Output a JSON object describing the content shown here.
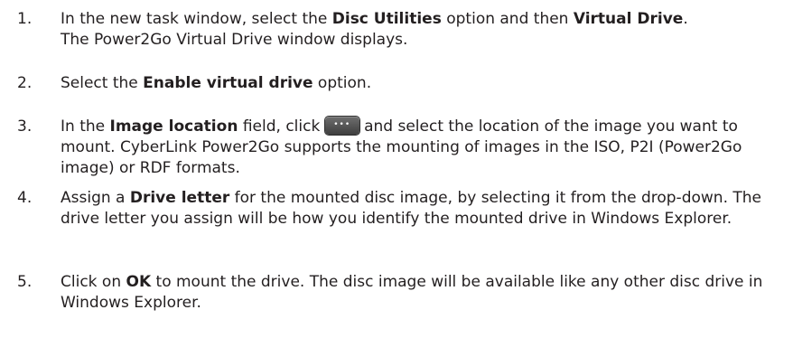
{
  "steps": [
    {
      "number": "1.",
      "parts": {
        "a": "In the new task window, select the ",
        "b": "Disc Utilities",
        "c": " option and then ",
        "d": "Virtual Drive",
        "e": ".",
        "f": "The Power2Go Virtual Drive window displays."
      }
    },
    {
      "number": "2.",
      "parts": {
        "a": "Select the ",
        "b": "Enable virtual drive",
        "c": " option."
      }
    },
    {
      "number": "3.",
      "parts": {
        "a": "In the ",
        "b": "Image location",
        "c": " field, click ",
        "d": " and select the location of the image you want to mount. CyberLink Power2Go supports the mounting of images in the ISO, P2I (Power2Go image) or RDF formats."
      }
    },
    {
      "number": "4.",
      "parts": {
        "a": "Assign a ",
        "b": "Drive letter",
        "c": " for the mounted disc image, by selecting it from the drop-down. The drive letter you assign will be how you identify the mounted drive in Windows Explorer."
      }
    },
    {
      "number": "5.",
      "parts": {
        "a": "Click on ",
        "b": "OK",
        "c": " to mount the drive. The disc image will be available like any other disc drive in Windows Explorer."
      }
    }
  ],
  "icons": {
    "browse_button": "ellipsis-browse-icon"
  }
}
